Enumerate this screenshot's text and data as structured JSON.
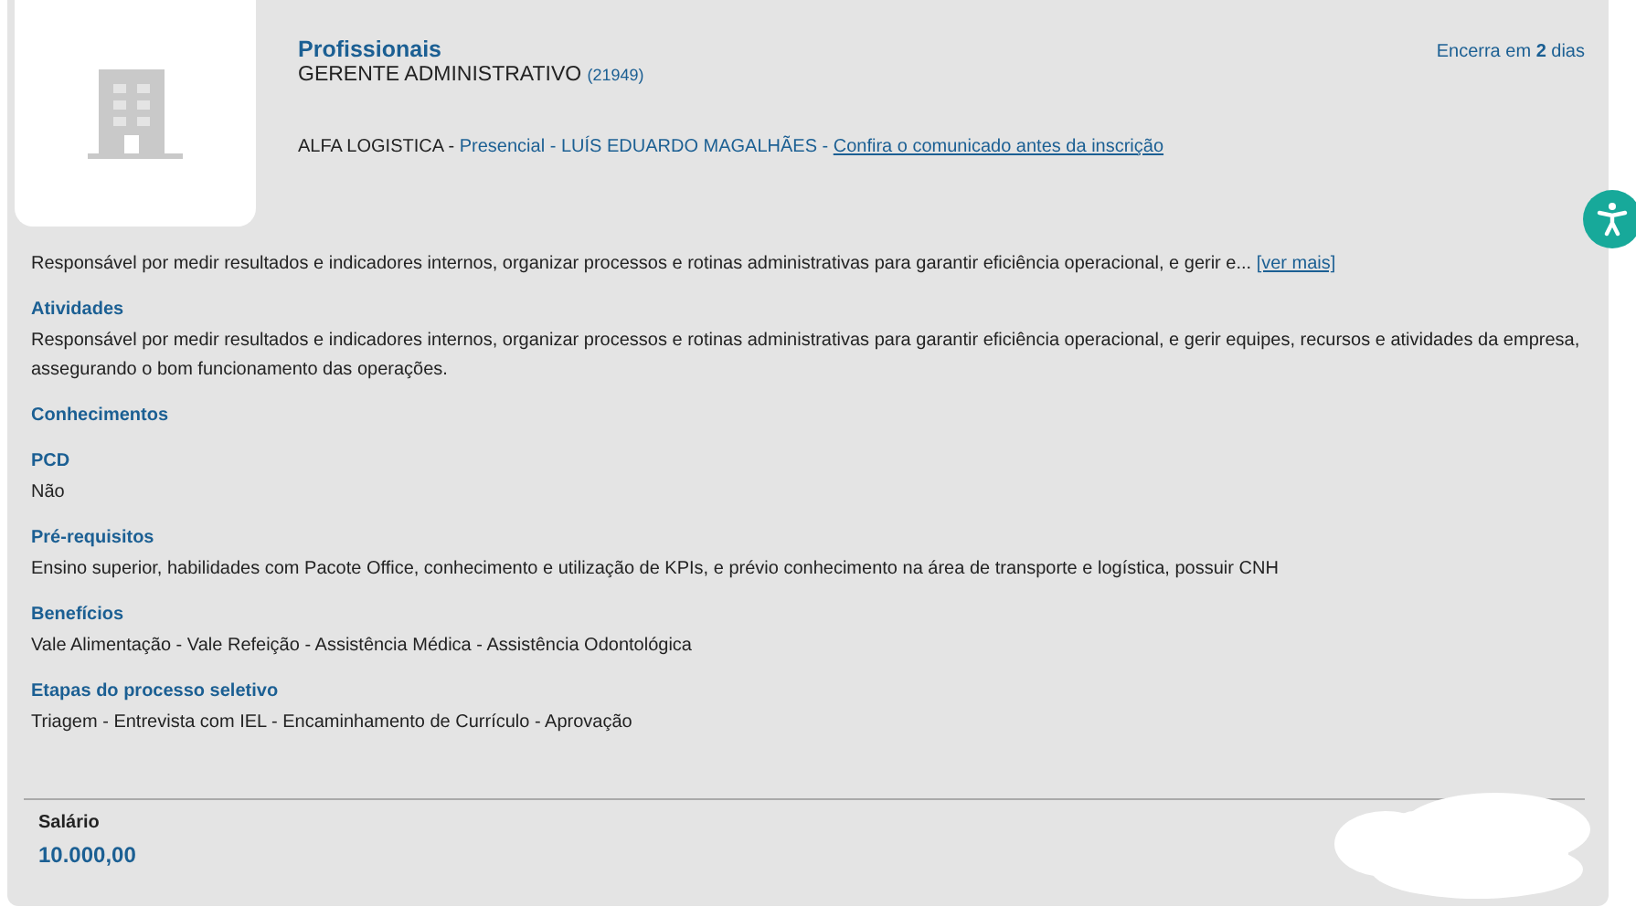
{
  "header": {
    "category": "Profissionais",
    "job_title": "GERENTE ADMINISTRATIVO",
    "job_code": "(21949)",
    "deadline": "Encerra em **2** dias",
    "company": "ALFA LOGISTICA - ",
    "work_mode_location": "Presencial - LUÍS EDUARDO MAGALHÃES - ",
    "notice_link": "Confira o comunicado antes da inscrição"
  },
  "summary": {
    "text": "Responsável por medir resultados e indicadores internos, organizar processos e rotinas administrativas para garantir eficiência operacional, e gerir e...",
    "more_link": "[ver mais]"
  },
  "sections": [
    {
      "heading": "Atividades",
      "text": "Responsável por medir resultados e indicadores internos, organizar processos e rotinas administrativas para garantir eficiência operacional, e gerir equipes, recursos e atividades da empresa, assegurando o bom funcionamento das operações."
    },
    {
      "heading": "Conhecimentos"
    },
    {
      "heading": "PCD",
      "text": "Não"
    },
    {
      "heading": "Pré-requisitos",
      "text": "Ensino superior, habilidades com Pacote Office, conhecimento e utilização de KPIs, e prévio conhecimento na área de transporte e logística, possuir CNH"
    },
    {
      "heading": "Benefícios",
      "text": "Vale Alimentação - Vale Refeição - Assistência Médica - Assistência Odontológica"
    },
    {
      "heading": "Etapas do processo seletivo",
      "text": "Triagem - Entrevista com IEL - Encaminhamento de Currículo - Aprovação"
    }
  ],
  "salary": {
    "label": "Salário",
    "value": "10.000,00"
  }
}
